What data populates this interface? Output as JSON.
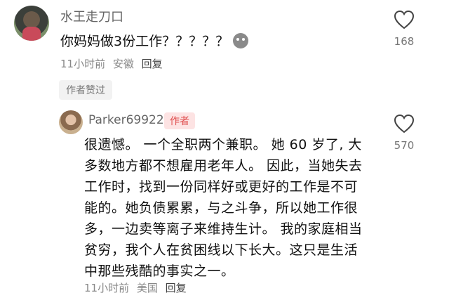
{
  "main_comment": {
    "username": "水王走刀口",
    "text": "你妈妈做3份工作？？？？？",
    "time": "11小时前",
    "location": "安徽",
    "reply_label": "回复",
    "likes": "168",
    "author_liked": "作者赞过"
  },
  "reply_comment": {
    "username": "Parker69922",
    "badge": "作者",
    "text": "很遗憾。 一个全职两个兼职。 她 60 岁了, 大多数地方都不想雇用老年人。 因此，当她失去工作时，找到一份同样好或更好的工作是不可能的。她负债累累，与之斗争，所以她工作很多，一边卖等离子来维持生计。 我的家庭相当贫穷，我个人在贫困线以下长大。这只是生活中那些残酷的事实之一。",
    "time": "11小时前",
    "location": "美国",
    "reply_label": "回复",
    "likes": "570"
  }
}
